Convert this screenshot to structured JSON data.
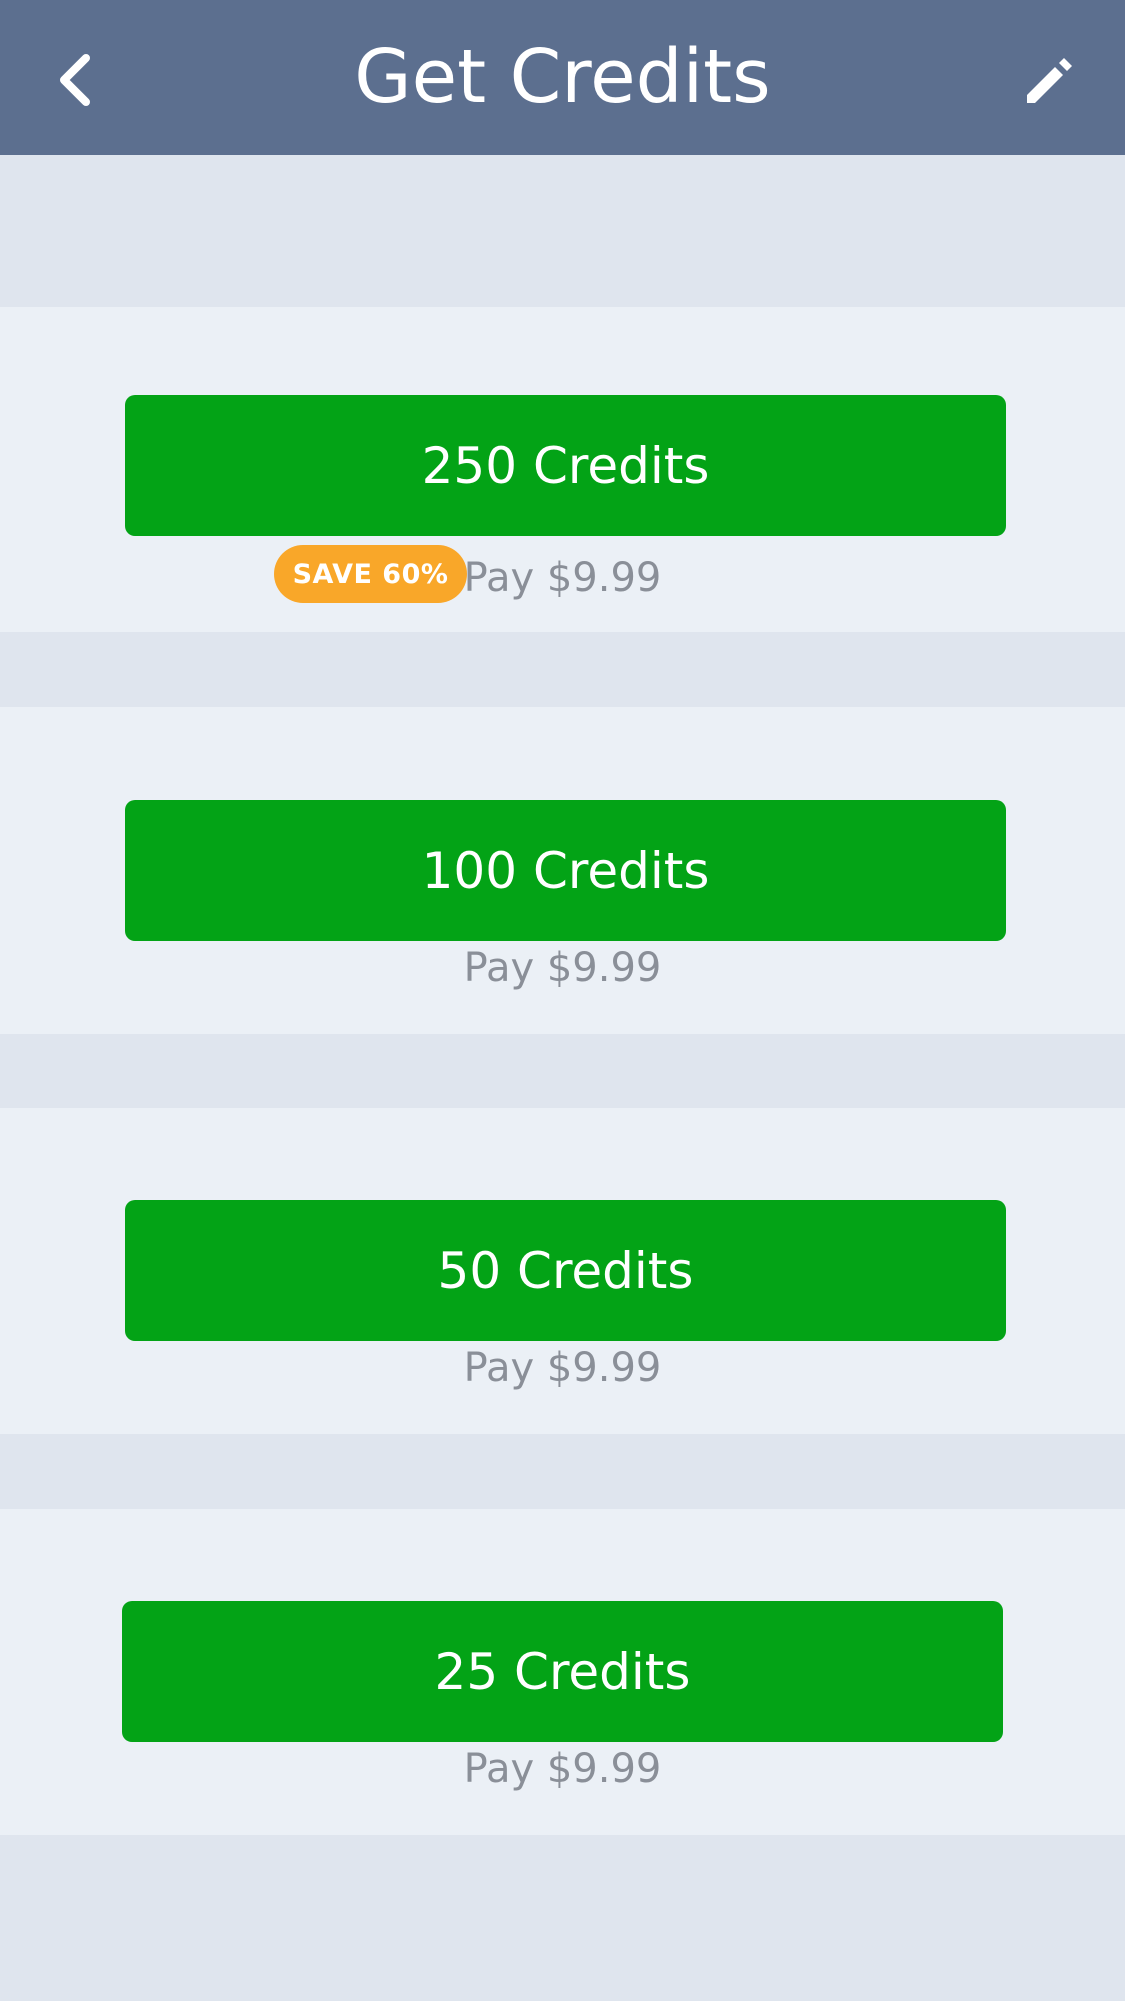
{
  "header": {
    "title": "Get Credits",
    "back_icon": "chevron-left-icon",
    "edit_icon": "pencil-icon",
    "background": "#5c6f8f"
  },
  "colors": {
    "button_green": "#03a316",
    "badge_orange": "#f9a729",
    "page_background": "#dfe5ee",
    "card_background": "#ebf0f6",
    "price_text": "#8a8f98"
  },
  "packages": [
    {
      "label": "250 Credits",
      "price": "Pay $9.99",
      "badge": "SAVE 60%"
    },
    {
      "label": "100 Credits",
      "price": "Pay $9.99"
    },
    {
      "label": "50 Credits",
      "price": "Pay $9.99"
    },
    {
      "label": "25 Credits",
      "price": "Pay $9.99"
    }
  ]
}
